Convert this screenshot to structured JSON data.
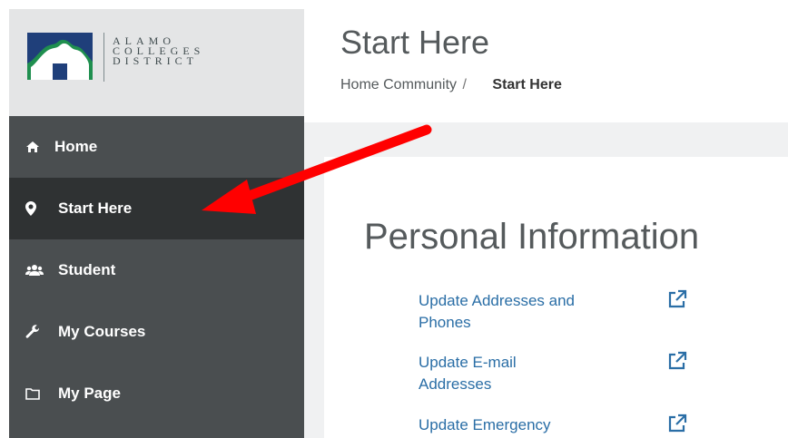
{
  "logo": {
    "line1": "ALAMO",
    "line2": "COLLEGES",
    "line3": "DISTRICT"
  },
  "sidebar": {
    "items": [
      {
        "label": "Home",
        "icon": "home-icon"
      },
      {
        "label": "Start Here",
        "icon": "map-marker-icon",
        "active": true
      },
      {
        "label": "Student",
        "icon": "users-icon"
      },
      {
        "label": "My Courses",
        "icon": "wrench-icon"
      },
      {
        "label": "My Page",
        "icon": "folder-icon"
      }
    ]
  },
  "header": {
    "title": "Start Here",
    "breadcrumb": {
      "parent": "Home Community",
      "separator": "/",
      "current": "Start Here"
    }
  },
  "content": {
    "heading": "Personal Information",
    "links": [
      {
        "line1": "Update Addresses and",
        "line2": "Phones"
      },
      {
        "line1": "Update E-mail",
        "line2": "Addresses"
      },
      {
        "line1": "Update Emergency",
        "line2": ""
      }
    ]
  },
  "colors": {
    "sidebar_bg": "#4a4e50",
    "sidebar_active_bg": "#2f3233",
    "logo_bg": "#e4e5e6",
    "logo_green": "#1f8f4f",
    "logo_blue": "#1f3f7a",
    "link": "#2a6ea6",
    "annotation_arrow": "#ff0000"
  }
}
